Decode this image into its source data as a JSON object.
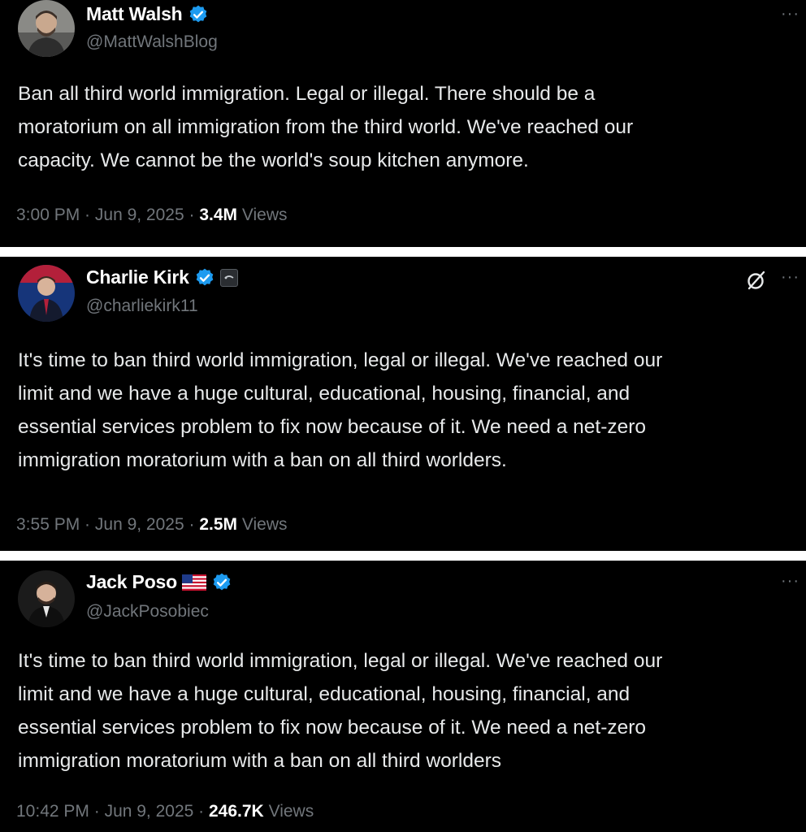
{
  "tweets": [
    {
      "display_name": "Matt Walsh",
      "handle": "@MattWalshBlog",
      "body": "Ban all third world immigration. Legal or illegal. There should be a\nmoratorium on all immigration from the third world. We've reached our\ncapacity. We cannot be the world's soup kitchen anymore.",
      "time": "3:00 PM",
      "date": "Jun 9, 2025",
      "views_count": "3.4M",
      "views_label": "Views",
      "more": "···"
    },
    {
      "display_name": "Charlie Kirk",
      "handle": "@charliekirk11",
      "body": "It's time to ban third world immigration, legal or illegal. We've reached our\nlimit and we have a huge cultural, educational, housing, financial, and\nessential services problem to fix now because of it. We need a net-zero\nimmigration moratorium with a ban on all third worlders.",
      "time": "3:55 PM",
      "date": "Jun 9, 2025",
      "views_count": "2.5M",
      "views_label": "Views",
      "more": "···"
    },
    {
      "display_name": "Jack Poso",
      "handle": "@JackPosobiec",
      "body": "It's time to ban third world immigration, legal or illegal. We've reached our\nlimit and we have a huge cultural, educational, housing, financial, and\nessential services problem to fix now because of it. We need a net-zero\nimmigration moratorium with a ban on all third worlders",
      "time": "10:42 PM",
      "date": "Jun 9, 2025",
      "views_count": "246.7K",
      "views_label": "Views",
      "more": "···"
    }
  ],
  "separator": " · ",
  "icons": {
    "verified": "verified-badge-icon",
    "grok": "grok-icon",
    "flag": "us-flag-icon",
    "affiliate": "affiliate-badge-icon"
  },
  "colors": {
    "background": "#000000",
    "text": "#e7e9ea",
    "secondary": "#71767b",
    "verified": "#1d9bf0",
    "divider": "#ffffff"
  }
}
